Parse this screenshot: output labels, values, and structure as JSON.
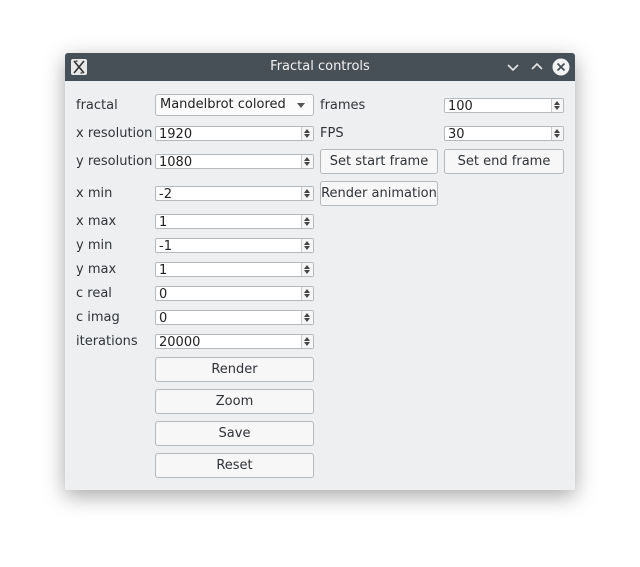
{
  "window": {
    "title": "Fractal controls",
    "icon": "app-icon",
    "controls": [
      "minimize-icon",
      "maximize-icon",
      "close-icon"
    ]
  },
  "form": {
    "fractal": {
      "label": "fractal",
      "value": "Mandelbrot colored"
    },
    "x_resolution": {
      "label": "x resolution",
      "value": "1920"
    },
    "y_resolution": {
      "label": "y resolution",
      "value": "1080"
    },
    "x_min": {
      "label": "x min",
      "value": "-2"
    },
    "x_max": {
      "label": "x max",
      "value": "1"
    },
    "y_min": {
      "label": "y min",
      "value": "-1"
    },
    "y_max": {
      "label": "y max",
      "value": "1"
    },
    "c_real": {
      "label": "c real",
      "value": "0"
    },
    "c_imag": {
      "label": "c imag",
      "value": "0"
    },
    "iterations": {
      "label": "iterations",
      "value": "20000"
    }
  },
  "animation": {
    "frames": {
      "label": "frames",
      "value": "100"
    },
    "fps": {
      "label": "FPS",
      "value": "30"
    },
    "set_start_frame": "Set start frame",
    "set_end_frame": "Set end frame",
    "render_animation": "Render animation"
  },
  "buttons": {
    "render": "Render",
    "zoom": "Zoom",
    "save": "Save",
    "reset": "Reset"
  }
}
